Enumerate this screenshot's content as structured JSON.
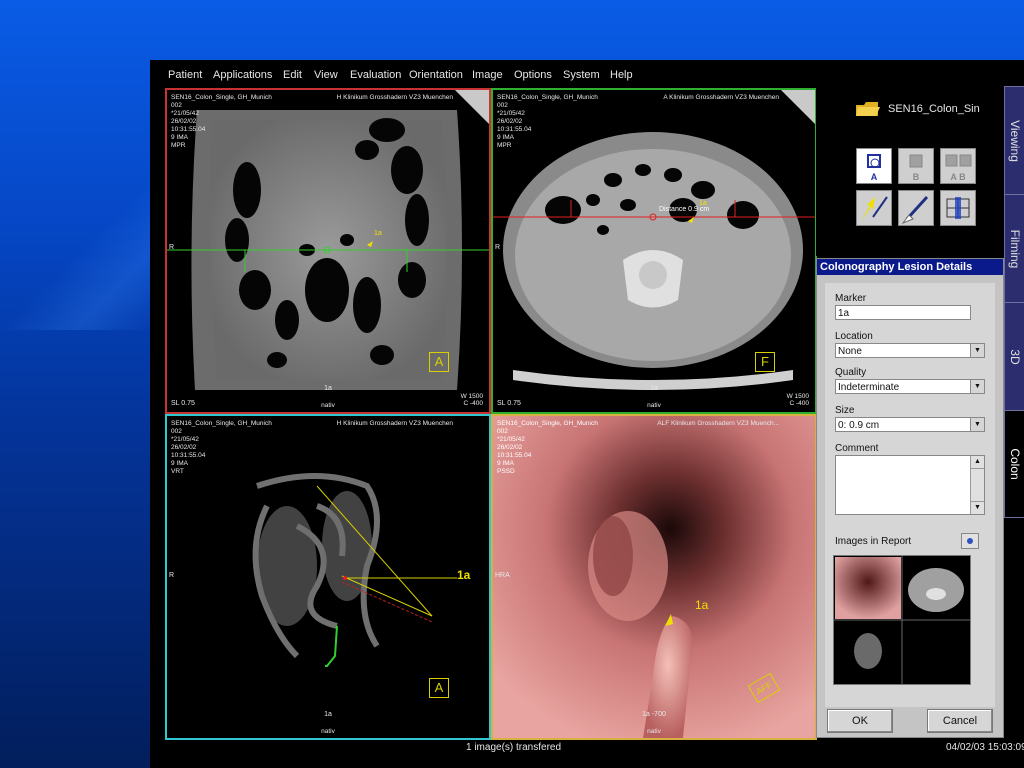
{
  "menu": [
    "Patient",
    "Applications",
    "Edit",
    "View",
    "Evaluation",
    "Orientation",
    "Image",
    "Options",
    "System",
    "Help"
  ],
  "viewports": {
    "tl": {
      "info": "SEN16_Colon_Single, GH_Munich\n002\n*21/05/42\n26/02/02\n10:31:55.04\n9 IMA\nMPR",
      "hosp": "H Klinikum Grosshadern VZ3 Muenchen",
      "sl": "SL 0.75",
      "w": "W 1500",
      "c": "C  -400",
      "nativ": "nativ",
      "tag": "1a",
      "marker": "1a",
      "r": "R",
      "ortho": "A"
    },
    "tr": {
      "info": "SEN16_Colon_Single, GH_Munich\n002\n*21/05/42\n26/02/02\n10:31:55.04\n9 IMA\nMPR",
      "hosp": "A Klinikum Grosshadern VZ3 Muenchen",
      "sl": "SL 0.75",
      "w": "W 1500",
      "c": "C  -400",
      "nativ": "nativ",
      "tag": "1a",
      "marker": "1a",
      "distance": "Distance 0.9 cm",
      "r": "R",
      "ortho": "F"
    },
    "bl": {
      "info": "SEN16_Colon_Single, GH_Munich\n002\n*21/05/42\n26/02/02\n10:31:55.04\n9 IMA\nVRT",
      "hosp": "H Klinikum Grosshadern VZ3 Muenchen",
      "nativ": "nativ",
      "tag": "1a",
      "marker": "1a",
      "r": "R",
      "ortho": "A"
    },
    "br": {
      "info": "SEN16_Colon_Single, GH_Munich\n002\n*21/05/42\n26/02/02\n10:31:55.04\n9 IMA\nPSSD",
      "hosp": "ALF Klinikum Grosshadern VZ3 Muench...",
      "nativ": "nativ",
      "tag": "1a  -700",
      "marker": "1a",
      "r": "HRA",
      "ortho": "AFF"
    }
  },
  "patient_folder": "SEN16_Colon_Sin",
  "tools": {
    "a": "A",
    "b": "B",
    "ab": "A  B"
  },
  "tabs": [
    "Viewing",
    "Filming",
    "3D",
    "Colon"
  ],
  "lesion": {
    "title": "Colonography Lesion Details",
    "marker_label": "Marker",
    "marker_value": "1a",
    "location_label": "Location",
    "location_value": "None",
    "quality_label": "Quality",
    "quality_value": "Indeterminate",
    "size_label": "Size",
    "size_value": "0: 0.9  cm",
    "comment_label": "Comment",
    "images_label": "Images in Report",
    "ok": "OK",
    "cancel": "Cancel"
  },
  "status": {
    "message": "1 image(s) transfered",
    "datetime": "04/02/03 15:03:09"
  }
}
